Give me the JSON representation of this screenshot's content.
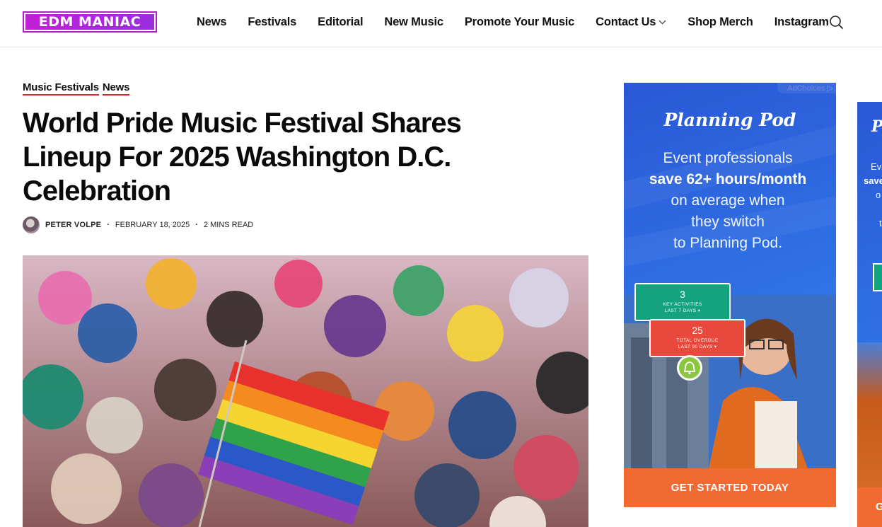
{
  "header": {
    "logo_text": "EDM MANIAC",
    "nav": [
      {
        "label": "News"
      },
      {
        "label": "Festivals"
      },
      {
        "label": "Editorial"
      },
      {
        "label": "New Music"
      },
      {
        "label": "Promote Your Music"
      },
      {
        "label": "Contact Us",
        "has_dropdown": true
      },
      {
        "label": "Shop Merch"
      },
      {
        "label": "Instagram"
      }
    ],
    "search_icon": "search-icon"
  },
  "article": {
    "categories": [
      "Music Festivals",
      "News"
    ],
    "title": "World Pride Music Festival Shares Lineup For 2025 Washington D.C. Celebration",
    "author": "PETER VOLPE",
    "date": "FEBRUARY 18, 2025",
    "read_time": "2 MINS READ",
    "meta_separator": "·"
  },
  "ad": {
    "adchoices": "AdChoices",
    "brand": "Planning Pod",
    "line1": "Event professionals",
    "line2": "save 62+ hours/month",
    "line3": "on average when",
    "line4": "they switch",
    "line5": "to Planning Pod.",
    "card1": {
      "value": "3",
      "label": "KEY ACTIVITIES",
      "sub": "LAST 7 DAYS ▾"
    },
    "card2": {
      "value": "25",
      "label": "TOTAL OVERDUE",
      "sub": "LAST 90 DAYS ▾"
    },
    "cta": "GET STARTED TODAY"
  },
  "ad2": {
    "brand": "P",
    "t1": "Ev",
    "t2": "save",
    "t3": "o",
    "t4": "t",
    "cta": "G"
  },
  "colors": {
    "brand_magenta": "#c21fd6",
    "category_underline": "#e32424",
    "ad_blue": "#2f73e6",
    "ad_cta_orange": "#f06a32",
    "card_green": "#13a37f",
    "card_red": "#e8493c"
  }
}
